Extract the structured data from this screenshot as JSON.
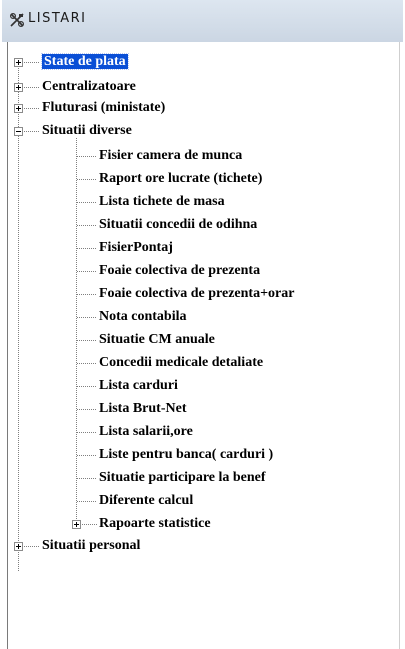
{
  "window": {
    "title": "LISTARI"
  },
  "tree": {
    "roots": [
      {
        "label": "State de plata",
        "expanded": false,
        "selected": true
      },
      {
        "label": "Centralizatoare",
        "expanded": false
      },
      {
        "label": "Fluturasi (ministate)",
        "expanded": false
      },
      {
        "label": "Situatii diverse",
        "expanded": true,
        "children": [
          "Fisier camera de munca",
          "Raport ore lucrate (tichete)",
          "Lista tichete de masa",
          "Situatii concedii de odihna",
          "FisierPontaj",
          "Foaie colectiva de prezenta",
          "Foaie colectiva de prezenta+orar",
          "Nota contabila",
          "Situatie CM anuale",
          "Concedii medicale detaliate",
          "Lista carduri",
          "Lista Brut-Net",
          "Lista salarii,ore",
          "Liste pentru banca( carduri )",
          "Situatie participare la benef",
          "Diferente calcul",
          "Rapoarte statistice"
        ]
      },
      {
        "label": "Situatii personal",
        "expanded": false
      }
    ]
  },
  "colors": {
    "selection": "#0a4fd6",
    "titlebar": "#d3dde9"
  },
  "icons": {
    "title": "tools-icon"
  }
}
